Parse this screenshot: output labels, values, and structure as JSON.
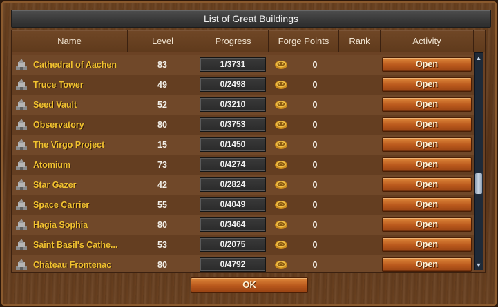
{
  "dialog": {
    "title": "List of Great Buildings",
    "ok_label": "OK"
  },
  "columns": {
    "name": "Name",
    "level": "Level",
    "progress": "Progress",
    "forge_points": "Forge Points",
    "rank": "Rank",
    "activity": "Activity"
  },
  "colors": {
    "name_text": "#f2c230",
    "button": "#b9581c",
    "progress_box": "#2d2d2d"
  },
  "buildings": [
    {
      "name": "Cathedral of Aachen",
      "level": "83",
      "progress": "1/3731",
      "forge_points": "0",
      "rank": "",
      "action": "Open",
      "icon": "cathedral-icon"
    },
    {
      "name": "Truce Tower",
      "level": "49",
      "progress": "0/2498",
      "forge_points": "0",
      "rank": "",
      "action": "Open",
      "icon": "tower-icon"
    },
    {
      "name": "Seed Vault",
      "level": "52",
      "progress": "0/3210",
      "forge_points": "0",
      "rank": "",
      "action": "Open",
      "icon": "vault-icon"
    },
    {
      "name": "Observatory",
      "level": "80",
      "progress": "0/3753",
      "forge_points": "0",
      "rank": "",
      "action": "Open",
      "icon": "observatory-icon"
    },
    {
      "name": "The Virgo Project",
      "level": "15",
      "progress": "0/1450",
      "forge_points": "0",
      "rank": "",
      "action": "Open",
      "icon": "virgo-icon"
    },
    {
      "name": "Atomium",
      "level": "73",
      "progress": "0/4274",
      "forge_points": "0",
      "rank": "",
      "action": "Open",
      "icon": "atomium-icon"
    },
    {
      "name": "Star Gazer",
      "level": "42",
      "progress": "0/2824",
      "forge_points": "0",
      "rank": "",
      "action": "Open",
      "icon": "star-gazer-icon"
    },
    {
      "name": "Space Carrier",
      "level": "55",
      "progress": "0/4049",
      "forge_points": "0",
      "rank": "",
      "action": "Open",
      "icon": "space-carrier-icon"
    },
    {
      "name": "Hagia Sophia",
      "level": "80",
      "progress": "0/3464",
      "forge_points": "0",
      "rank": "",
      "action": "Open",
      "icon": "hagia-sophia-icon"
    },
    {
      "name": "Saint Basil's Cathe...",
      "level": "53",
      "progress": "0/2075",
      "forge_points": "0",
      "rank": "",
      "action": "Open",
      "icon": "saint-basils-icon"
    },
    {
      "name": "Château Frontenac",
      "level": "80",
      "progress": "0/4792",
      "forge_points": "0",
      "rank": "",
      "action": "Open",
      "icon": "chateau-icon"
    }
  ]
}
